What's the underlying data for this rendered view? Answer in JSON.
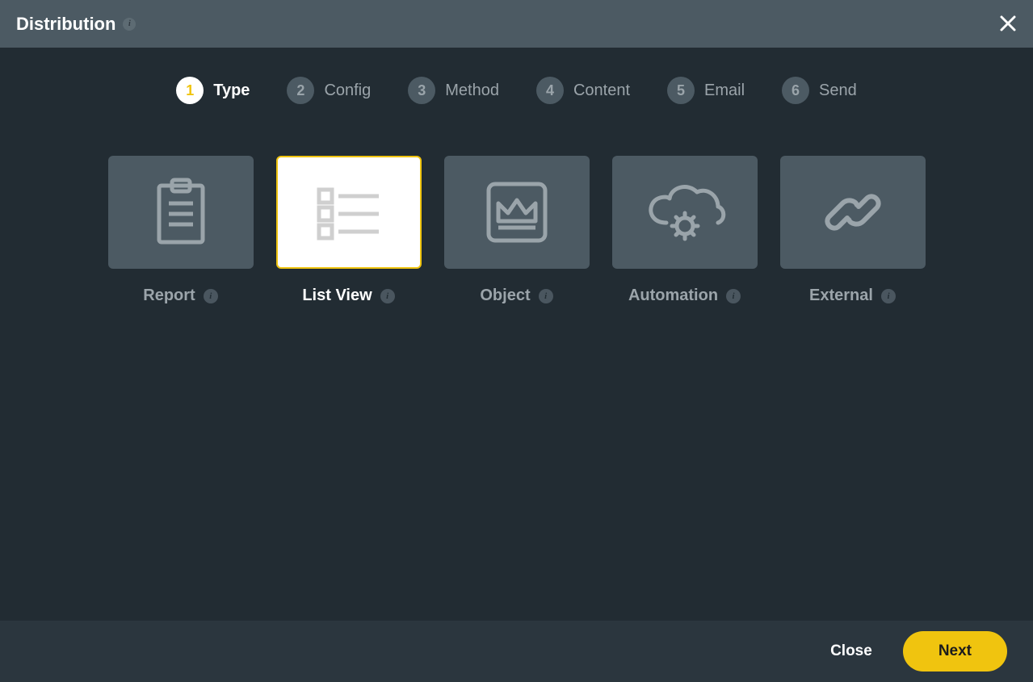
{
  "header": {
    "title": "Distribution"
  },
  "stepper": {
    "active_index": 0,
    "steps": [
      {
        "num": "1",
        "label": "Type"
      },
      {
        "num": "2",
        "label": "Config"
      },
      {
        "num": "3",
        "label": "Method"
      },
      {
        "num": "4",
        "label": "Content"
      },
      {
        "num": "5",
        "label": "Email"
      },
      {
        "num": "6",
        "label": "Send"
      }
    ]
  },
  "types": {
    "selected_index": 1,
    "items": [
      {
        "label": "Report",
        "icon": "clipboard-icon"
      },
      {
        "label": "List View",
        "icon": "list-icon"
      },
      {
        "label": "Object",
        "icon": "crown-box-icon"
      },
      {
        "label": "Automation",
        "icon": "cloud-gear-icon"
      },
      {
        "label": "External",
        "icon": "link-icon"
      }
    ]
  },
  "footer": {
    "close_label": "Close",
    "next_label": "Next"
  },
  "info_glyph": "i",
  "colors": {
    "accent": "#f0c40f",
    "panel": "#4c5a63",
    "bg": "#222c33",
    "footer": "#2b363e"
  }
}
